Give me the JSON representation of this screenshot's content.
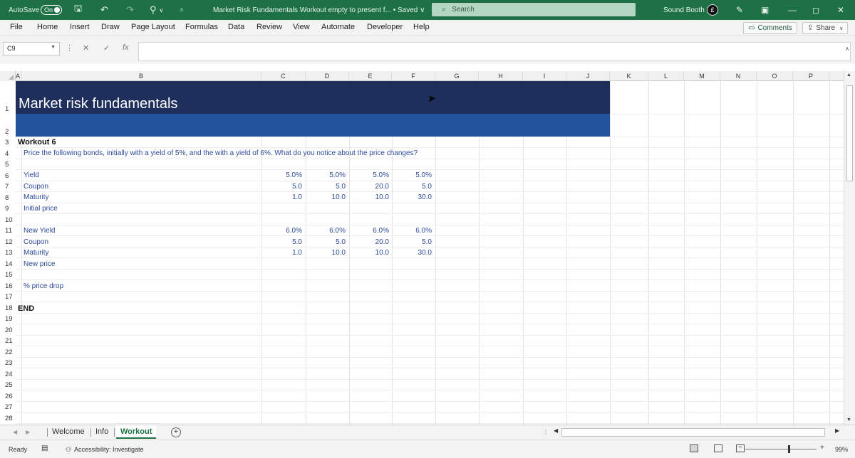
{
  "titlebar": {
    "autosave_label": "AutoSave",
    "autosave_state": "On",
    "document_title": "Market Risk Fundamentals Workout empty to present f...  •  Saved  ∨",
    "search_placeholder": "Search",
    "user_name": "Sound Booth",
    "user_initial": "£"
  },
  "ribbon": {
    "tabs": [
      "File",
      "Home",
      "Insert",
      "Draw",
      "Page Layout",
      "Formulas",
      "Data",
      "Review",
      "View",
      "Automate",
      "Developer",
      "Help"
    ],
    "comments_label": "Comments",
    "share_label": "Share"
  },
  "formula_bar": {
    "name_box": "C9",
    "formula": ""
  },
  "columns": [
    "A",
    "B",
    "C",
    "D",
    "E",
    "F",
    "G",
    "H",
    "I",
    "J",
    "K",
    "L",
    "M",
    "N",
    "O",
    "P"
  ],
  "rows": [
    "1",
    "2",
    "3",
    "4",
    "5",
    "6",
    "7",
    "8",
    "9",
    "10",
    "11",
    "12",
    "13",
    "14",
    "15",
    "16",
    "17",
    "18",
    "19",
    "20",
    "21",
    "22",
    "23",
    "24",
    "25",
    "26",
    "27",
    "28"
  ],
  "sheet": {
    "title": "Market risk fundamentals",
    "workout_heading": "Workout 6",
    "instructions": "Price the following bonds, initially with a yield of 5%, and the with a yield of 6%. What do you notice about the price changes?",
    "block1": {
      "labels": [
        "Yield",
        "Coupon",
        "Maturity",
        "Initial price"
      ],
      "values": [
        [
          "5.0%",
          "5.0%",
          "5.0%",
          "5.0%"
        ],
        [
          "5.0",
          "5.0",
          "20.0",
          "5.0"
        ],
        [
          "1.0",
          "10.0",
          "10.0",
          "30.0"
        ]
      ]
    },
    "block2": {
      "labels": [
        "New Yield",
        "Coupon",
        "Maturity",
        "New price"
      ],
      "values": [
        [
          "6.0%",
          "6.0%",
          "6.0%",
          "6.0%"
        ],
        [
          "5.0",
          "5.0",
          "20.0",
          "5.0"
        ],
        [
          "1.0",
          "10.0",
          "10.0",
          "30.0"
        ]
      ]
    },
    "price_drop_label": "% price drop",
    "end_label": "END"
  },
  "sheet_tabs": [
    "Welcome",
    "Info",
    "Workout"
  ],
  "active_sheet": "Workout",
  "status": {
    "ready": "Ready",
    "accessibility": "Accessibility: Investigate",
    "zoom": "99%"
  },
  "colors": {
    "excel_green": "#1e7145",
    "banner_dark": "#1f2f5c",
    "banner_mid": "#23539c",
    "data_blue": "#2c4a9a"
  }
}
